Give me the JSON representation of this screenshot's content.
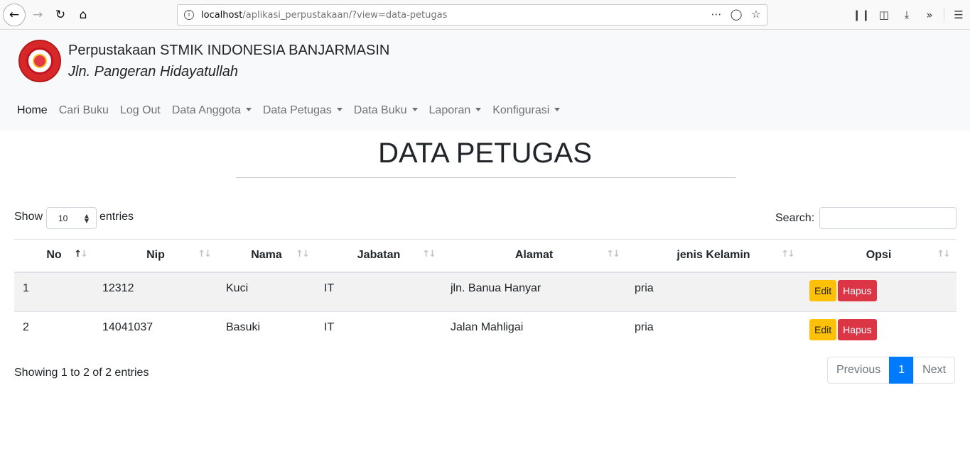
{
  "browser": {
    "url_host": "localhost",
    "url_path": "/aplikasi_perpustakaan/?view=data-petugas"
  },
  "site": {
    "title": "Perpustakaan STMIK INDONESIA BANJARMASIN",
    "subtitle": "Jln. Pangeran Hidayatullah",
    "logo_text": "STMIK"
  },
  "nav": {
    "items": [
      {
        "label": "Home",
        "dropdown": false,
        "active": true
      },
      {
        "label": "Cari Buku",
        "dropdown": false
      },
      {
        "label": "Log Out",
        "dropdown": false
      },
      {
        "label": "Data Anggota",
        "dropdown": true
      },
      {
        "label": "Data Petugas",
        "dropdown": true
      },
      {
        "label": "Data Buku",
        "dropdown": true
      },
      {
        "label": "Laporan",
        "dropdown": true
      },
      {
        "label": "Konfigurasi",
        "dropdown": true
      }
    ]
  },
  "page": {
    "title": "DATA PETUGAS",
    "show_label": "Show",
    "entries_value": "10",
    "entries_label": "entries",
    "search_label": "Search:",
    "info": "Showing 1 to 2 of 2 entries"
  },
  "table": {
    "headers": [
      "No",
      "Nip",
      "Nama",
      "Jabatan",
      "Alamat",
      "jenis Kelamin",
      "Opsi"
    ],
    "rows": [
      {
        "no": "1",
        "nip": "12312",
        "nama": "Kuci",
        "jabatan": "IT",
        "alamat": "jln. Banua Hanyar",
        "jk": "pria"
      },
      {
        "no": "2",
        "nip": "14041037",
        "nama": "Basuki",
        "jabatan": "IT",
        "alamat": "Jalan Mahligai",
        "jk": "pria"
      }
    ],
    "edit_label": "Edit",
    "delete_label": "Hapus"
  },
  "pagination": {
    "previous": "Previous",
    "current": "1",
    "next": "Next"
  },
  "colors": {
    "edit": "#ffc107",
    "delete": "#dc3545",
    "primary": "#007bff"
  }
}
